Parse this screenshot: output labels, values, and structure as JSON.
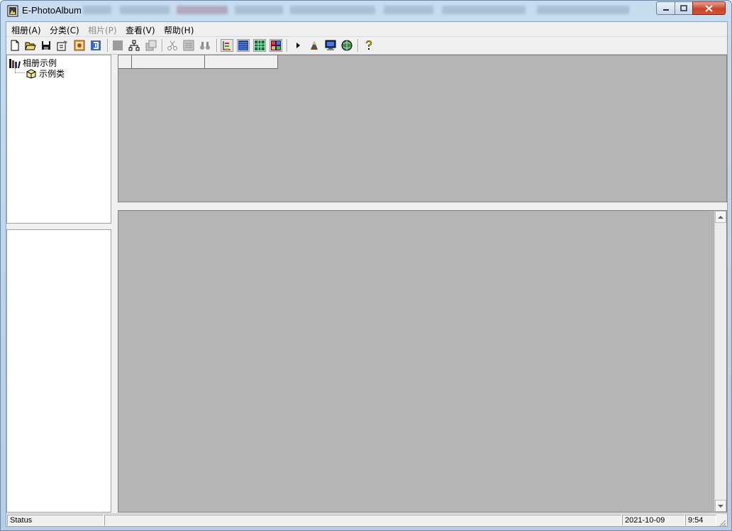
{
  "window": {
    "title": "E-PhotoAlbum",
    "controls": {
      "minimize": "minimize",
      "maximize": "maximize",
      "close": "close"
    }
  },
  "menu": {
    "items": [
      {
        "label": "相册(A)",
        "enabled": true
      },
      {
        "label": "分类(C)",
        "enabled": true
      },
      {
        "label": "相片(P)",
        "enabled": false
      },
      {
        "label": "查看(V)",
        "enabled": true
      },
      {
        "label": "帮助(H)",
        "enabled": true
      }
    ]
  },
  "toolbar": {
    "buttons": [
      "new-file-icon",
      "open-folder-icon",
      "save-icon",
      "properties-icon",
      "album-icon",
      "import-icon",
      "photo-gray-icon",
      "tree-structure-icon",
      "copy-gray-icon",
      "cut-gray-icon",
      "scan-gray-icon",
      "find-binoculars-icon",
      "tree-view-icon",
      "list-view-icon",
      "grid-view-icon",
      "thumbnail-view-icon",
      "play-icon",
      "slideshow-icon",
      "monitor-icon",
      "web-globe-icon",
      "help-icon"
    ]
  },
  "tree": {
    "root": "相册示例",
    "child": "示例类"
  },
  "status": {
    "text": "Status",
    "date": "2021-10-09",
    "time": "9:54"
  }
}
